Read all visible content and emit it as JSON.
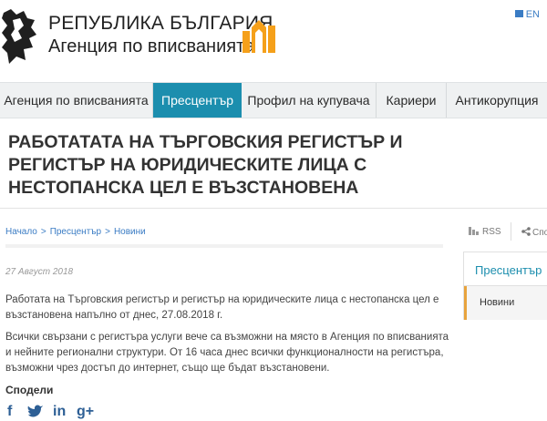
{
  "header": {
    "title_line1": "РЕПУБЛИКА БЪЛГАРИЯ",
    "title_line2": "Агенция по вписванията",
    "lang": "EN",
    "lion_icon": "bulgarian-coat-of-arms-icon",
    "logo_icon": "registry-agency-logo-icon"
  },
  "nav": {
    "items": [
      {
        "label": "Агенция по вписванията"
      },
      {
        "label": "Пресцентър"
      },
      {
        "label": "Профил на купувача"
      },
      {
        "label": "Кариери"
      },
      {
        "label": "Антикорупция"
      }
    ],
    "active_index": 1
  },
  "article": {
    "headline": "РАБОТАТАТА НА ТЪРГОВСКИЯ РЕГИСТЪР И РЕГИСТЪР НА ЮРИДИЧЕСКИТЕ ЛИЦА С НЕСТОПАНСКА ЦЕЛ Е ВЪЗСТАНОВЕНА",
    "breadcrumb": [
      "Начало",
      "Пресцентър",
      "Новини"
    ],
    "rss": "RSS",
    "share_top": "Спо",
    "date": "27 Август 2018",
    "paragraph1": "Работата на Търговския регистър и регистър на юридическите лица с нестопанска цел е възстановена напълно от днес, 27.08.2018 г.",
    "paragraph2": "Всички свързани с регистъра услуги вече са възможни на място в Агенция по вписванията и нейните регионални структури. От 16 часа днес всички функционалности на регистъра, възможни чрез достъп до интернет, също ще бъдат възстановени.",
    "share_label": "Сподели",
    "social_icons": [
      "facebook-icon",
      "twitter-icon",
      "linkedin-icon",
      "google-plus-icon"
    ]
  },
  "sidebar": {
    "title": "Пресцентър",
    "items": [
      {
        "label": "Новини"
      }
    ]
  },
  "colors": {
    "accent": "#1c8eae",
    "link": "#3a7cc4",
    "sidebar_marker": "#e8a33d",
    "logo_orange": "#f5a01a"
  }
}
